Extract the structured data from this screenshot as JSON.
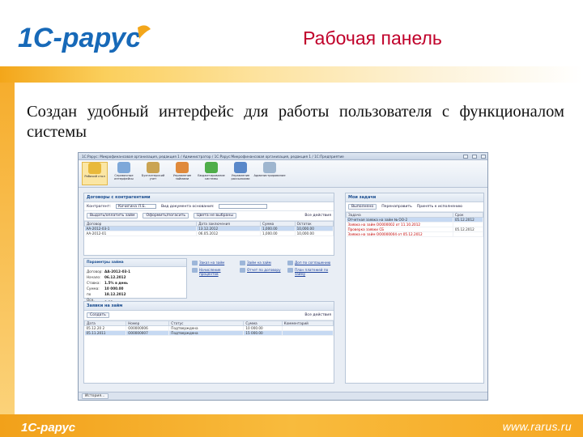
{
  "slide": {
    "title": "Рабочая панель",
    "body": "Создан удобный интерфейс для работы пользователя с функционалом системы",
    "website": "www.rarus.ru",
    "logo_text": "1С-рарус"
  },
  "colors": {
    "accent_orange": "#f3a61a",
    "title_red": "#c0002a",
    "app_blue": "#1d4f91"
  },
  "app": {
    "window_title": "1С:Рарус: Микрофинансовая организация, редакция 1 / Администратор / 1С:Рарус:Микрофинансовая организация, редакция 1 / 1С:Предприятие",
    "toolbar": [
      {
        "label": "Рабочий стол",
        "icon": "desktop-icon",
        "color": "#e9b93a"
      },
      {
        "label": "Справочные интерфейсы",
        "icon": "books-icon",
        "color": "#7ea8d9"
      },
      {
        "label": "Бухгалтерский учет",
        "icon": "ledger-icon",
        "color": "#caa453"
      },
      {
        "label": "Управление займами",
        "icon": "person-icon",
        "color": "#e08a3c"
      },
      {
        "label": "Бюджетирование системы",
        "icon": "globe-icon",
        "color": "#4fae4a"
      },
      {
        "label": "Управление рассылками",
        "icon": "mail-icon",
        "color": "#5a88c9"
      },
      {
        "label": "Администрирование",
        "icon": "admin-icon",
        "color": "#9fb6cf"
      }
    ],
    "contracts": {
      "title": "Договоры с контрагентами",
      "filter_label": "Контрагент:",
      "filter_value": "Кичигина Л.Б.",
      "period_label": "Вид документа основания:",
      "toolbar": [
        "Выдать/оплатить займ",
        "Оформить/погасить",
        "Цвета не выбраны",
        "Все действия"
      ],
      "columns": [
        "Договор",
        "Дата заключения",
        "Сумма",
        "Остаток"
      ],
      "rows": [
        {
          "name": "АА-2012-03-1",
          "date": "13.12.2012",
          "sum": "1,000.00",
          "rest": "10,000.00",
          "selected": true
        },
        {
          "name": "АА-2012-01",
          "date": "06.05.2012",
          "sum": "1,000.00",
          "rest": "10,000.00",
          "selected": false
        }
      ]
    },
    "params": {
      "title": "Параметры займа",
      "rows": [
        {
          "label": "Договор:",
          "value": "АА-2012-03-1"
        },
        {
          "label": "Начало:",
          "value": "06.12.2012"
        },
        {
          "label": "Ставка:",
          "value": "1.5% в день"
        },
        {
          "label": "Сумма:",
          "value": "10 000.00"
        }
      ],
      "end_label": "по",
      "end_value": "18.12.2012",
      "extra_label": "Осн. долг:",
      "extra_value": "0.00"
    },
    "links": [
      "Заказ на займ",
      "Займ на займ",
      "Доп по соглашению",
      "Начисление процентов",
      "Отчет по договору",
      "План платежей по займу"
    ],
    "loans": {
      "title": "Заявки на займ",
      "toolbar": [
        "Создать",
        "Все действия"
      ],
      "columns": [
        "Дата",
        "Номер",
        "Статус",
        "Сумма",
        "Комментарий"
      ],
      "rows": [
        {
          "date": "05.12.20 2",
          "num": "О00000006",
          "status": "Подтверждена",
          "sum": "10 000.00",
          "selected": false
        },
        {
          "date": "05.11.2011",
          "num": "О00000007",
          "status": "Подтверждена",
          "sum": "15 000.00",
          "selected": true
        }
      ]
    },
    "tasks": {
      "title": "Мои задачи",
      "toolbar": [
        "Выполнено",
        "Перенаправить",
        "Принять к исполнению"
      ],
      "columns": [
        "Задача",
        "Срок"
      ],
      "rows": [
        {
          "text": "Отчетная заявка на займ № ОО-2",
          "date": "05.12.2012",
          "selected": true
        },
        {
          "text": "Заявка на займ ОО000002 от 11.10.2012",
          "date": "",
          "selected": false
        },
        {
          "text": "Проверка заявки СБ",
          "date": "05.12.2012",
          "selected": false
        },
        {
          "text": "Заявка на займ ОО0000004 от 05.12.2012",
          "date": "",
          "selected": false
        }
      ]
    },
    "status_button": "История..."
  }
}
